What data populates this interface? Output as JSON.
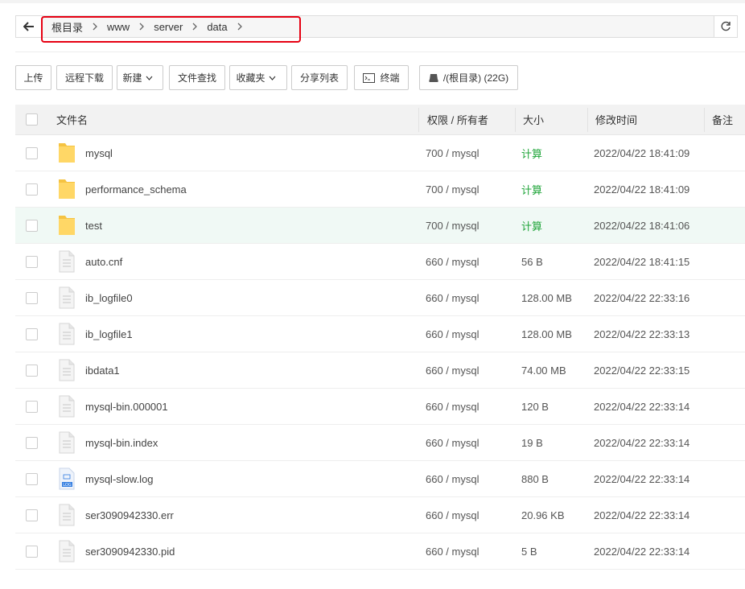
{
  "breadcrumb": [
    "根目录",
    "www",
    "server",
    "data"
  ],
  "toolbar": {
    "upload": "上传",
    "remote_download": "远程下载",
    "new": "新建",
    "file_search": "文件查找",
    "favorites": "收藏夹",
    "share_list": "分享列表",
    "terminal": "终端",
    "disk": "/(根目录) (22G)"
  },
  "table": {
    "headers": {
      "name": "文件名",
      "perm": "权限 / 所有者",
      "size": "大小",
      "mtime": "修改时间",
      "note": "备注"
    },
    "rows": [
      {
        "type": "folder",
        "name": "mysql",
        "perm": "700 / mysql",
        "size": "计算",
        "mtime": "2022/04/22 18:41:09"
      },
      {
        "type": "folder",
        "name": "performance_schema",
        "perm": "700 / mysql",
        "size": "计算",
        "mtime": "2022/04/22 18:41:09"
      },
      {
        "type": "folder",
        "name": "test",
        "perm": "700 / mysql",
        "size": "计算",
        "mtime": "2022/04/22 18:41:06"
      },
      {
        "type": "file",
        "name": "auto.cnf",
        "perm": "660 / mysql",
        "size": "56 B",
        "mtime": "2022/04/22 18:41:15"
      },
      {
        "type": "file",
        "name": "ib_logfile0",
        "perm": "660 / mysql",
        "size": "128.00 MB",
        "mtime": "2022/04/22 22:33:16"
      },
      {
        "type": "file",
        "name": "ib_logfile1",
        "perm": "660 / mysql",
        "size": "128.00 MB",
        "mtime": "2022/04/22 22:33:13"
      },
      {
        "type": "file",
        "name": "ibdata1",
        "perm": "660 / mysql",
        "size": "74.00 MB",
        "mtime": "2022/04/22 22:33:15"
      },
      {
        "type": "file",
        "name": "mysql-bin.000001",
        "perm": "660 / mysql",
        "size": "120 B",
        "mtime": "2022/04/22 22:33:14"
      },
      {
        "type": "file",
        "name": "mysql-bin.index",
        "perm": "660 / mysql",
        "size": "19 B",
        "mtime": "2022/04/22 22:33:14"
      },
      {
        "type": "log",
        "name": "mysql-slow.log",
        "perm": "660 / mysql",
        "size": "880 B",
        "mtime": "2022/04/22 22:33:14"
      },
      {
        "type": "file",
        "name": "ser3090942330.err",
        "perm": "660 / mysql",
        "size": "20.96 KB",
        "mtime": "2022/04/22 22:33:14"
      },
      {
        "type": "file",
        "name": "ser3090942330.pid",
        "perm": "660 / mysql",
        "size": "5 B",
        "mtime": "2022/04/22 22:33:14"
      }
    ]
  },
  "log_icon_text": "LOG",
  "colors": {
    "accent_green": "#20a53a",
    "highlight_row": "#f0f9f5",
    "annotation_red": "#e60012",
    "folder": "#f5c342"
  }
}
